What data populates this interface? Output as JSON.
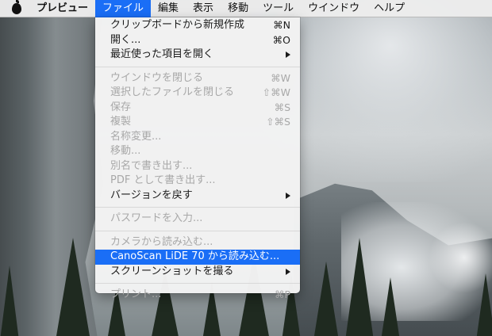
{
  "menubar": {
    "app_name": "プレビュー",
    "menus": [
      "ファイル",
      "編集",
      "表示",
      "移動",
      "ツール",
      "ウインドウ",
      "ヘルプ"
    ]
  },
  "file_menu": {
    "new_from_clipboard": {
      "label": "クリップボードから新規作成",
      "shortcut": "⌘N"
    },
    "open": {
      "label": "開く...",
      "shortcut": "⌘O"
    },
    "open_recent": {
      "label": "最近使った項目を開く"
    },
    "close_window": {
      "label": "ウインドウを閉じる",
      "shortcut": "⌘W"
    },
    "close_selected": {
      "label": "選択したファイルを閉じる",
      "shortcut": "⇧⌘W"
    },
    "save": {
      "label": "保存",
      "shortcut": "⌘S"
    },
    "duplicate": {
      "label": "複製",
      "shortcut": "⇧⌘S"
    },
    "rename": {
      "label": "名称変更..."
    },
    "move": {
      "label": "移動..."
    },
    "save_as": {
      "label": "別名で書き出す..."
    },
    "export_pdf": {
      "label": "PDF として書き出す..."
    },
    "revert": {
      "label": "バージョンを戻す"
    },
    "password": {
      "label": "パスワードを入力..."
    },
    "import_camera": {
      "label": "カメラから読み込む..."
    },
    "import_scanner": {
      "label": "CanoScan LiDE 70 から読み込む..."
    },
    "screenshot": {
      "label": "スクリーンショットを撮る"
    },
    "print": {
      "label": "プリント...",
      "shortcut": "⌘P"
    }
  },
  "colors": {
    "highlight": "#1a6ef6",
    "disabled_text": "#a8a8a8"
  }
}
